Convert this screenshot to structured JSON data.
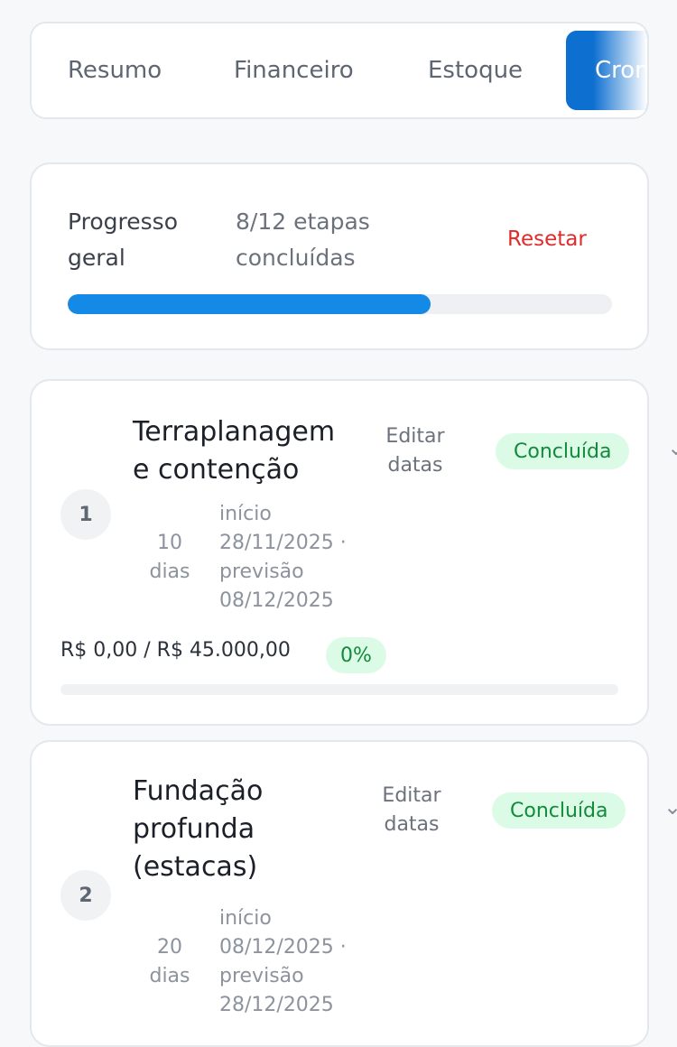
{
  "tabs": [
    {
      "label": "Resumo"
    },
    {
      "label": "Financeiro"
    },
    {
      "label": "Estoque"
    },
    {
      "label": "Cronograma"
    }
  ],
  "progress": {
    "label": "Progresso geral",
    "count": "8/12 etapas concluídas",
    "reset_label": "Resetar",
    "completed": 8,
    "total": 12
  },
  "stages": [
    {
      "number": "1",
      "title": "Terraplanagem e contenção",
      "edit_label": "Editar datas",
      "status": "Concluída",
      "duration": "10 dias",
      "dates": "início 28/11/2025 · previsão 08/12/2025",
      "budget": "R$ 0,00 / R$ 45.000,00",
      "budget_percent": "0%",
      "budget_fraction": 0
    },
    {
      "number": "2",
      "title": "Fundação profunda (estacas)",
      "edit_label": "Editar datas",
      "status": "Concluída",
      "duration": "20 dias",
      "dates": "início 08/12/2025 · previsão 28/12/2025"
    }
  ],
  "colors": {
    "accent": "#0d6fd0",
    "progress": "#1589e6",
    "success_bg": "#dcfbe6",
    "success_text": "#128a3c",
    "danger": "#e02b2b"
  }
}
